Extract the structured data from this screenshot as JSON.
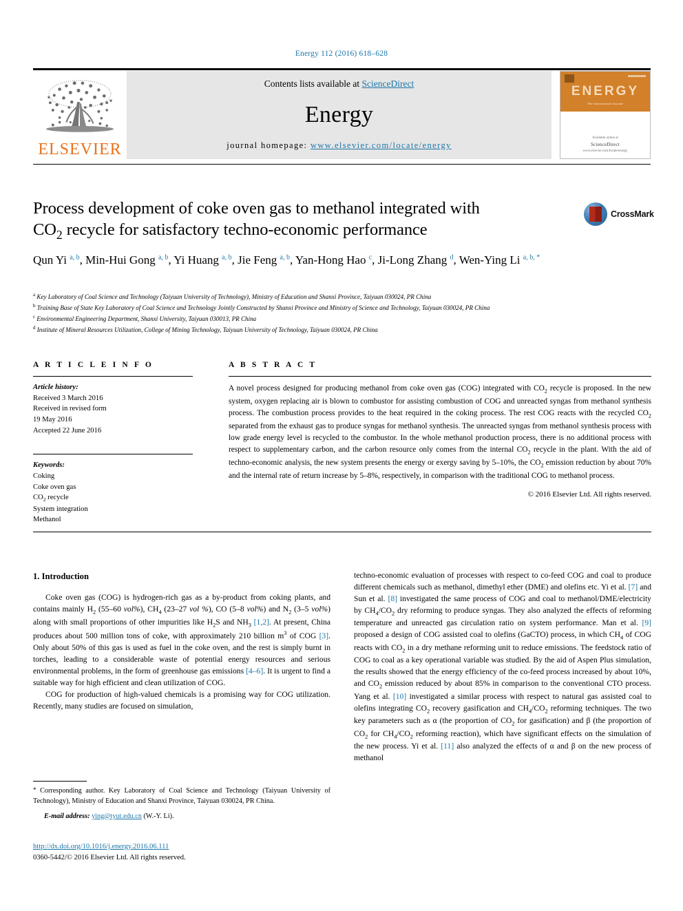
{
  "running_head": "Energy 112 (2016) 618–628",
  "masthead": {
    "contents_prefix": "Contents lists available at ",
    "sciencedirect": "ScienceDirect",
    "journal_name": "Energy",
    "homepage_prefix": "journal homepage: ",
    "homepage_url": "www.elsevier.com/locate/energy",
    "publisher_logo_text": "ELSEVIER",
    "cover": {
      "title": "ENERGY",
      "subtitle": "The International Journal",
      "footer_line1": "Available online at",
      "footer_line2": "ScienceDirect",
      "footer_line3": "www.elsevier.com/locate/energy"
    }
  },
  "article": {
    "title_line1": "Process development of coke oven gas to methanol integrated with",
    "title_line2_pre": "CO",
    "title_line2_sub": "2",
    "title_line2_post": " recycle for satisfactory techno-economic performance",
    "crossmark_label": "CrossMark",
    "authors_html": "Qun Yi <sup>a, b</sup>, Min-Hui Gong <sup>a, b</sup>, Yi Huang <sup>a, b</sup>, Jie Feng <sup>a, b</sup>, Yan-Hong Hao <sup>c</sup>, Ji-Long Zhang <sup>d</sup>, Wen-Ying Li <sup>a, b, *</sup>",
    "affiliations": [
      {
        "marker": "a",
        "text": "Key Laboratory of Coal Science and Technology (Taiyuan University of Technology), Ministry of Education and Shanxi Province, Taiyuan 030024, PR China"
      },
      {
        "marker": "b",
        "text": "Training Base of State Key Laboratory of Coal Science and Technology Jointly Constructed by Shanxi Province and Ministry of Science and Technology, Taiyuan 030024, PR China"
      },
      {
        "marker": "c",
        "text": "Environmental Engineering Department, Shanxi University, Taiyuan 030013, PR China"
      },
      {
        "marker": "d",
        "text": "Institute of Mineral Resources Utilization, College of Mining Technology, Taiyuan University of Technology, Taiyuan 030024, PR China"
      }
    ]
  },
  "article_info": {
    "heading": "A R T I C L E  I N F O",
    "history_label": "Article history:",
    "history": [
      "Received 3 March 2016",
      "Received in revised form",
      "19 May 2016",
      "Accepted 22 June 2016"
    ],
    "keywords_label": "Keywords:",
    "keywords": [
      "Coking",
      "Coke oven gas",
      "CO2 recycle",
      "System integration",
      "Methanol"
    ]
  },
  "abstract": {
    "heading": "A B S T R A C T",
    "text_html": "A novel process designed for producing methanol from coke oven gas (COG) integrated with CO<sub>2</sub> recycle is proposed. In the new system, oxygen replacing air is blown to combustor for assisting combustion of COG and unreacted syngas from methanol synthesis process. The combustion process provides to the heat required in the coking process. The rest COG reacts with the recycled CO<sub>2</sub> separated from the exhaust gas to produce syngas for methanol synthesis. The unreacted syngas from methanol synthesis process with low grade energy level is recycled to the combustor. In the whole methanol production process, there is no additional process with respect to supplementary carbon, and the carbon resource only comes from the internal CO<sub>2</sub> recycle in the plant. With the aid of techno-economic analysis, the new system presents the energy or exergy saving by 5&ndash;10%, the CO<sub>2</sub> emission reduction by about 70% and the internal rate of return increase by 5&ndash;8%, respectively, in comparison with the traditional COG to methanol process.",
    "copyright": "© 2016 Elsevier Ltd. All rights reserved."
  },
  "body": {
    "section_number_title": "1.  Introduction",
    "left_paragraphs_html": [
      "Coke oven gas (COG) is hydrogen-rich gas as a by-product from coking plants, and contains mainly H<sub>2</sub> (55&ndash;60 <span class=\"it\">vol%</span>), CH<sub>4</sub> (23&ndash;27 <span class=\"it\">vol %</span>), CO (5&ndash;8 <span class=\"it\">vol%</span>) and N<sub>2</sub> (3&ndash;5 <span class=\"it\">vol%</span>) along with small proportions of other impurities like H<sub>2</sub>S and NH<sub>3</sub> <span class=\"ref\">[1,2]</span>. At present, China produces about 500 million tons of coke, with approximately 210 billion m<sup class=\"num\">3</sup> of COG <span class=\"ref\">[3]</span>. Only about 50% of this gas is used as fuel in the coke oven, and the rest is simply burnt in torches, leading to a considerable waste of potential energy resources and serious environmental problems, in the form of greenhouse gas emissions <span class=\"ref\">[4&ndash;6]</span>. It is urgent to find a suitable way for high efficient and clean utilization of COG.",
      "COG for production of high-valued chemicals is a promising way for COG utilization. Recently, many studies are focused on simulation,"
    ],
    "right_paragraphs_html": [
      "techno-economic evaluation of processes with respect to co-feed COG and coal to produce different chemicals such as methanol, dimethyl ether (DME) and olefins etc. Yi et al. <span class=\"ref\">[7]</span> and Sun et al. <span class=\"ref\">[8]</span> investigated the same process of COG and coal to methanol/DME/electricity by CH<sub>4</sub>/CO<sub>2</sub> dry reforming to produce syngas. They also analyzed the effects of reforming temperature and unreacted gas circulation ratio on system performance. Man et al. <span class=\"ref\">[9]</span> proposed a design of COG assisted coal to olefins (GaCTO) process, in which CH<sub>4</sub> of COG reacts with CO<sub>2</sub> in a dry methane reforming unit to reduce emissions. The feedstock ratio of COG to coal as a key operational variable was studied. By the aid of Aspen Plus simulation, the results showed that the energy efficiency of the co-feed process increased by about 10%, and CO<sub>2</sub> emission reduced by about 85% in comparison to the conventional CTO process. Yang et al. <span class=\"ref\">[10]</span> investigated a similar process with respect to natural gas assisted coal to olefins integrating CO<sub>2</sub> recovery gasification and CH<sub>4</sub>/CO<sub>2</sub> reforming techniques. The two key parameters such as &alpha; (the proportion of CO<sub>2</sub> for gasification) and &beta; (the proportion of CO<sub>2</sub> for CH<sub>4</sub>/CO<sub>2</sub> reforming reaction), which have significant effects on the simulation of the new process. Yi et al. <span class=\"ref\">[11]</span> also analyzed the effects of &alpha; and &beta; on the new process of methanol"
    ]
  },
  "footnotes": {
    "corresponding_html": "<span class=\"fn-star\">*</span> Corresponding author. Key Laboratory of Coal Science and Technology (Taiyuan University of Technology), Ministry of Education and Shanxi Province, Taiyuan 030024, PR China.",
    "email_label": "E-mail address:",
    "email": "ying@tyut.edu.cn",
    "email_suffix": "(W.-Y. Li)."
  },
  "doi_block": {
    "doi_url": "http://dx.doi.org/10.1016/j.energy.2016.06.111",
    "issn_line": "0360-5442/© 2016 Elsevier Ltd. All rights reserved."
  },
  "colors": {
    "link_blue": "#1a75a8",
    "elsevier_orange": "#E9711C",
    "masthead_gray": "#e6e6e6",
    "cover_orange": "#D2802A"
  }
}
